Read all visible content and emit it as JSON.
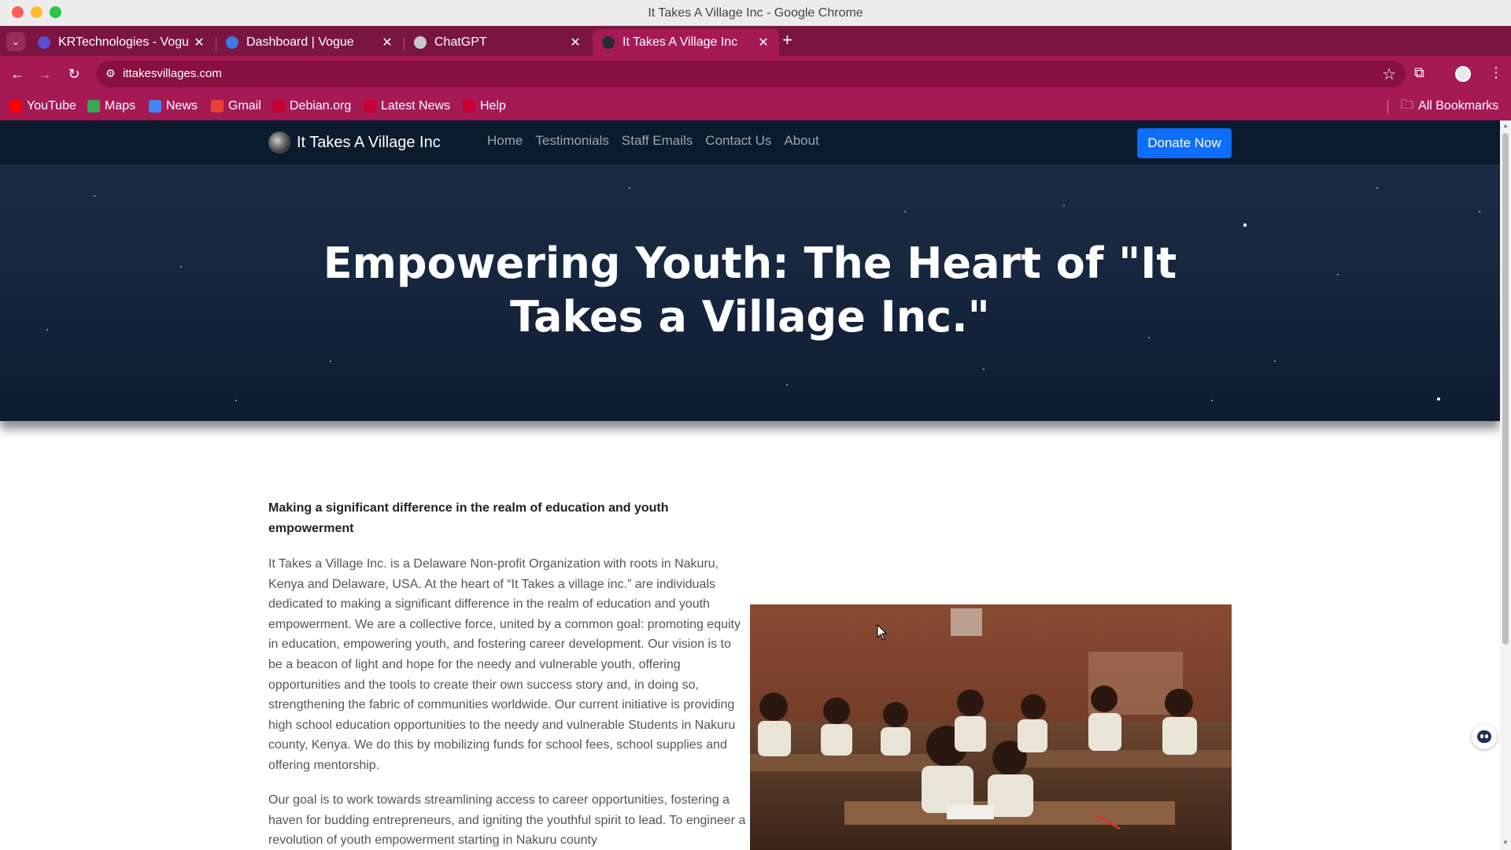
{
  "window": {
    "title": "It Takes A Village Inc - Google Chrome"
  },
  "tabs": [
    {
      "label": "KRTechnologies - Vogue",
      "fav_color": "#5b4fd6"
    },
    {
      "label": "Dashboard | Vogue",
      "fav_color": "#3d7be0"
    },
    {
      "label": "ChatGPT",
      "fav_color": "#c9c9c9"
    },
    {
      "label": "It Takes A Village Inc",
      "fav_color": "#2a2a2a"
    }
  ],
  "address_bar": {
    "url": "ittakesvillages.com"
  },
  "bookmarks": [
    {
      "label": "YouTube",
      "icon_color": "#ff0000"
    },
    {
      "label": "Maps",
      "icon_color": "#34a853"
    },
    {
      "label": "News",
      "icon_color": "#4285f4"
    },
    {
      "label": "Gmail",
      "icon_color": "#ea4335"
    },
    {
      "label": "Debian.org",
      "icon_color": "#c70036"
    },
    {
      "label": "Latest News",
      "icon_color": "#c70036"
    },
    {
      "label": "Help",
      "icon_color": "#c70036"
    }
  ],
  "all_bookmarks": "All Bookmarks",
  "site": {
    "brand": "It Takes A Village Inc",
    "nav": [
      "Home",
      "Testimonials",
      "Staff Emails",
      "Contact Us",
      "About"
    ],
    "donate": "Donate Now",
    "hero_title": "Empowering Youth: The Heart of \"It Takes a Village Inc.\"",
    "lead_heading": "Making a significant difference in the realm of education and youth empowerment",
    "paragraph1": "It Takes a Village Inc. is a Delaware Non-profit Organization with roots in Nakuru, Kenya and Delaware, USA. At the heart of “It Takes a village inc.” are individuals dedicated to making a significant difference in the realm of education and youth empowerment. We are a collective force, united by a common goal: promoting equity in education, empowering youth, and fostering career development. Our vision is to be a beacon of light and hope for the needy and vulnerable youth, offering opportunities and the tools to create their own success story and, in doing so, strengthening the fabric of communities worldwide. Our current initiative is providing high school education opportunities to the needy and vulnerable Students in Nakuru county, Kenya. We do this by mobilizing funds for school fees, school supplies and offering mentorship.",
    "paragraph2": "Our goal is to work towards streamlining access to career opportunities, fostering a haven for budding entrepreneurs, and igniting the youthful spirit to lead. To engineer a revolution of youth empowerment starting in Nakuru county"
  },
  "colors": {
    "tab_strip": "#7a1541",
    "toolbar": "#a51a55",
    "site_nav": "#0c1a2e",
    "donate_button": "#0d6efd"
  }
}
